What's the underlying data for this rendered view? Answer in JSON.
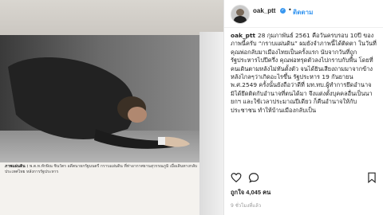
{
  "post": {
    "username": "oak_ptt",
    "follow_label": "ติดตาม",
    "caption_username": "oak_ptt",
    "caption_text": "28 กุมภาพันธ์ 2561 คือวันครบรอบ 10ปี ของภาพนี้ครับ “กราบแผ่นดิน” ผมยังจำภาพนี้ได้ติดตา ในวันที่คุณพ่อกลับมาเมืองไทยเป็นครั้งแรก นับจากวันที่ถูกรัฐประหารไปปีครึ่ง คุณพ่อทรุดตัวลงไปกราบกับพื้น โดยที่คนเดินตามหลังไม่ทันตั้งตัว จนได้ยินเสียงถามมาจากข้างหลังไกลๆว่าเกิดอะไรขึ้น รัฐประหาร 19 กันยายน พ.ศ.2549 ครั้งนั้นยังถือว่าดีที่ มท.ทบ.ผู้ทำการยึดอำนาจ มิได้ยึดติดกับอำนาจที่ตนได้มา จึงแต่งตั้งบุคคลอื่นเป็นนายกฯ และใช้เวลาประมาณปีเดียว ก็คืนอำนาจให้กับประชาชน ทำให้บ้านเมืองกลับเป็น",
    "likes": "ถูกใจ 4,045 คน",
    "timestamp": "9 ชั่วโมงที่แล้ว"
  },
  "photo": {
    "caption_lead": "ภาพแผ่นดิน :",
    "caption_text": "พ.ต.ท.ทักษิณ ชินวัตร อดีตนายกรัฐมนตรี กราบแผ่นดิน ที่ท่าอากาศยานสุวรรณภูมิ เมื่อเดินทางกลับประเทศไทย หลังการรัฐประหาร"
  },
  "icons": [
    "heart-icon",
    "comment-icon",
    "share-icon",
    "bookmark-icon"
  ],
  "colors": {
    "link": "#3897f0",
    "text": "#262626",
    "muted": "#999999"
  }
}
